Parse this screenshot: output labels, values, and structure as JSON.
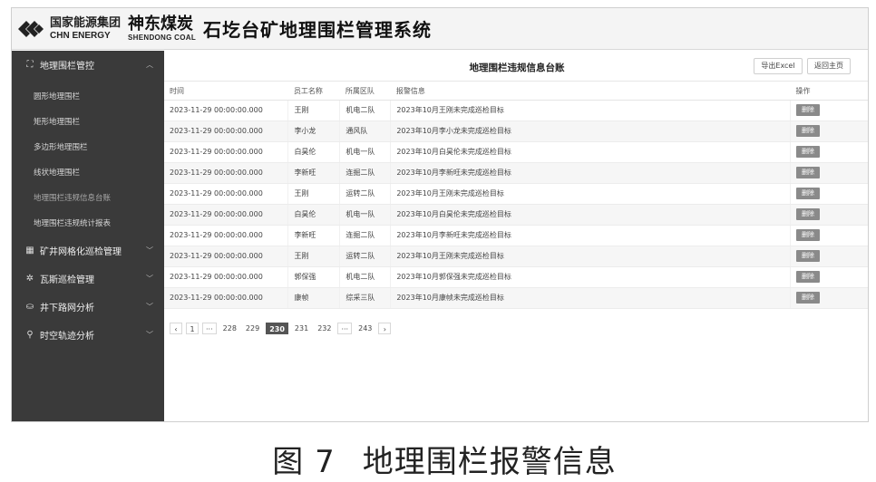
{
  "header": {
    "brand_cn": "国家能源集团",
    "brand_en": "CHN ENERGY",
    "brand2_cn": "神东煤炭",
    "brand2_en": "SHENDONG COAL",
    "system_title": "石圪台矿地理围栏管理系统"
  },
  "sidebar": {
    "groups": [
      {
        "icon": "fence-icon",
        "label": "地理围栏管控",
        "expanded": true
      },
      {
        "icon": "grid-icon",
        "label": "矿井网格化巡检管理",
        "expanded": false
      },
      {
        "icon": "gas-icon",
        "label": "瓦斯巡检管理",
        "expanded": false
      },
      {
        "icon": "network-icon",
        "label": "井下路网分析",
        "expanded": false
      },
      {
        "icon": "location-icon",
        "label": "时空轨迹分析",
        "expanded": false
      }
    ],
    "sub_items": [
      "圆形地理围栏",
      "矩形地理围栏",
      "多边形地理围栏",
      "线状地理围栏",
      "地理围栏违规信息台账",
      "地理围栏违规统计报表"
    ],
    "active_sub_item": "地理围栏违规信息台账"
  },
  "panel": {
    "title": "地理围栏违规信息台账",
    "export_label": "导出Excel",
    "home_label": "返回主页"
  },
  "table": {
    "columns": [
      "时间",
      "员工名称",
      "所属区队",
      "报警信息",
      "操作"
    ],
    "delete_label": "删除",
    "rows": [
      {
        "time": "2023-11-29 00:00:00.000",
        "name": "王刚",
        "team": "机电二队",
        "alarm": "2023年10月王刚未完成巡检目标"
      },
      {
        "time": "2023-11-29 00:00:00.000",
        "name": "李小龙",
        "team": "通风队",
        "alarm": "2023年10月李小龙未完成巡检目标"
      },
      {
        "time": "2023-11-29 00:00:00.000",
        "name": "白昊伦",
        "team": "机电一队",
        "alarm": "2023年10月白昊伦未完成巡检目标"
      },
      {
        "time": "2023-11-29 00:00:00.000",
        "name": "李新旺",
        "team": "连掘二队",
        "alarm": "2023年10月李新旺未完成巡检目标"
      },
      {
        "time": "2023-11-29 00:00:00.000",
        "name": "王刚",
        "team": "运转二队",
        "alarm": "2023年10月王刚未完成巡检目标"
      },
      {
        "time": "2023-11-29 00:00:00.000",
        "name": "白昊伦",
        "team": "机电一队",
        "alarm": "2023年10月白昊伦未完成巡检目标"
      },
      {
        "time": "2023-11-29 00:00:00.000",
        "name": "李新旺",
        "team": "连掘二队",
        "alarm": "2023年10月李新旺未完成巡检目标"
      },
      {
        "time": "2023-11-29 00:00:00.000",
        "name": "王刚",
        "team": "运转二队",
        "alarm": "2023年10月王刚未完成巡检目标"
      },
      {
        "time": "2023-11-29 00:00:00.000",
        "name": "郭保强",
        "team": "机电二队",
        "alarm": "2023年10月郭保强未完成巡检目标"
      },
      {
        "time": "2023-11-29 00:00:00.000",
        "name": "康帧",
        "team": "综采三队",
        "alarm": "2023年10月康帧未完成巡检目标"
      }
    ]
  },
  "pager": {
    "prev": "‹",
    "next": "›",
    "ellipsis": "···",
    "pages": [
      "1",
      "228",
      "229",
      "230",
      "231",
      "232",
      "243"
    ],
    "current": "230"
  },
  "caption": {
    "figure": "图 7",
    "text": "地理围栏报警信息"
  }
}
